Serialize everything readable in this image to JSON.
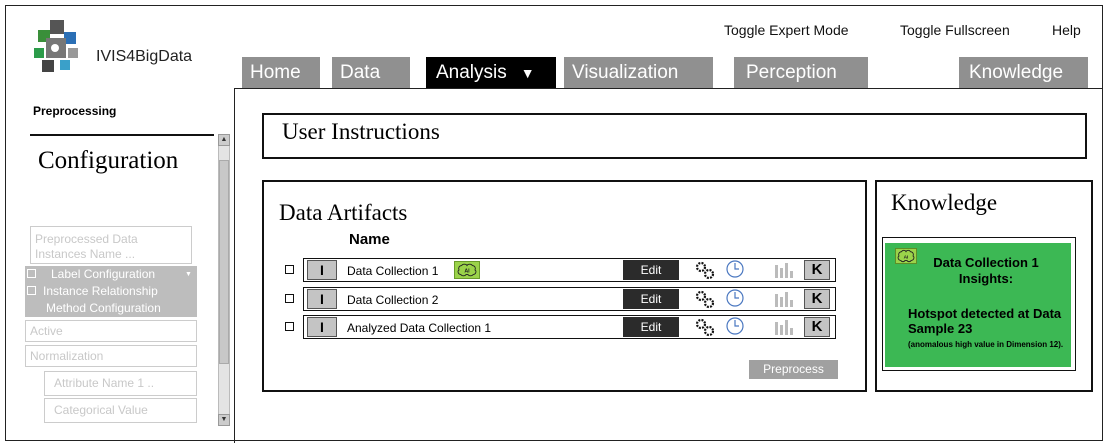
{
  "app": {
    "title": "IVIS4BigData"
  },
  "top_links": {
    "expert_mode": "Toggle Expert Mode",
    "fullscreen": "Toggle Fullscreen",
    "help": "Help"
  },
  "tabs": [
    {
      "label": "Home"
    },
    {
      "label": "Data"
    },
    {
      "label": "Analysis",
      "active": true,
      "caret": "▼"
    },
    {
      "label": "Visualization"
    },
    {
      "label": "Perception"
    },
    {
      "label": "Knowledge"
    }
  ],
  "sidebar": {
    "heading": "Preprocessing",
    "config_title": "Configuration",
    "fields": {
      "preprocessed_data": "Preprocessed Data",
      "instances_name": "Instances Name ...",
      "label_configuration": "Label Configuration",
      "instance_relationship": "Instance Relationship",
      "method_configuration": "Method Configuration",
      "active": "Active",
      "normalization": "Normalization",
      "attribute_name": "Attribute Name 1 ..",
      "categorical_value": "Categorical Value"
    },
    "dropdown_caret": "▼",
    "scroll_up": "▲",
    "scroll_down": "▼"
  },
  "user_instructions": {
    "title": "User Instructions"
  },
  "data_artifacts": {
    "title": "Data Artifacts",
    "column_name": "Name",
    "rows": [
      {
        "i_label": "I",
        "name": "Data Collection 1",
        "edit": "Edit",
        "k_label": "K",
        "has_ai": true
      },
      {
        "i_label": "I",
        "name": "Data Collection 2",
        "edit": "Edit",
        "k_label": "K",
        "has_ai": false
      },
      {
        "i_label": "I",
        "name": "Analyzed Data Collection 1",
        "edit": "Edit",
        "k_label": "K",
        "has_ai": false
      }
    ],
    "preprocess_label": "Preprocess"
  },
  "knowledge": {
    "title": "Knowledge",
    "card_title": "Data Collection 1 Insights:",
    "card_body": "Hotspot detected at Data Sample 23",
    "card_note": "(anomalous high value in Dimension 12).",
    "card_color": "#3cb854"
  },
  "icons": {
    "ai_badge": "brain-ai-icon",
    "gears": "gears-icon",
    "clock": "clock-icon",
    "bars": "bar-chart-icon"
  }
}
